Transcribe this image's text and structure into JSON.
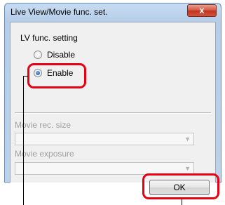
{
  "window": {
    "title": "Live View/Movie func. set.",
    "close_glyph": "x"
  },
  "lv_group": {
    "label": "LV func. setting",
    "options": [
      {
        "label": "Disable",
        "selected": false
      },
      {
        "label": "Enable",
        "selected": true
      }
    ]
  },
  "movie_rec_size": {
    "label": "Movie rec. size",
    "value": "",
    "enabled": false
  },
  "movie_exposure": {
    "label": "Movie exposure",
    "value": "",
    "enabled": false
  },
  "buttons": {
    "ok": "OK"
  },
  "colors": {
    "highlight": "#e60012",
    "title_bar": "#c7dcf2",
    "close_button": "#c3341c"
  },
  "icons": {
    "close": "close-icon",
    "dropdown": "chevron-down-icon"
  }
}
